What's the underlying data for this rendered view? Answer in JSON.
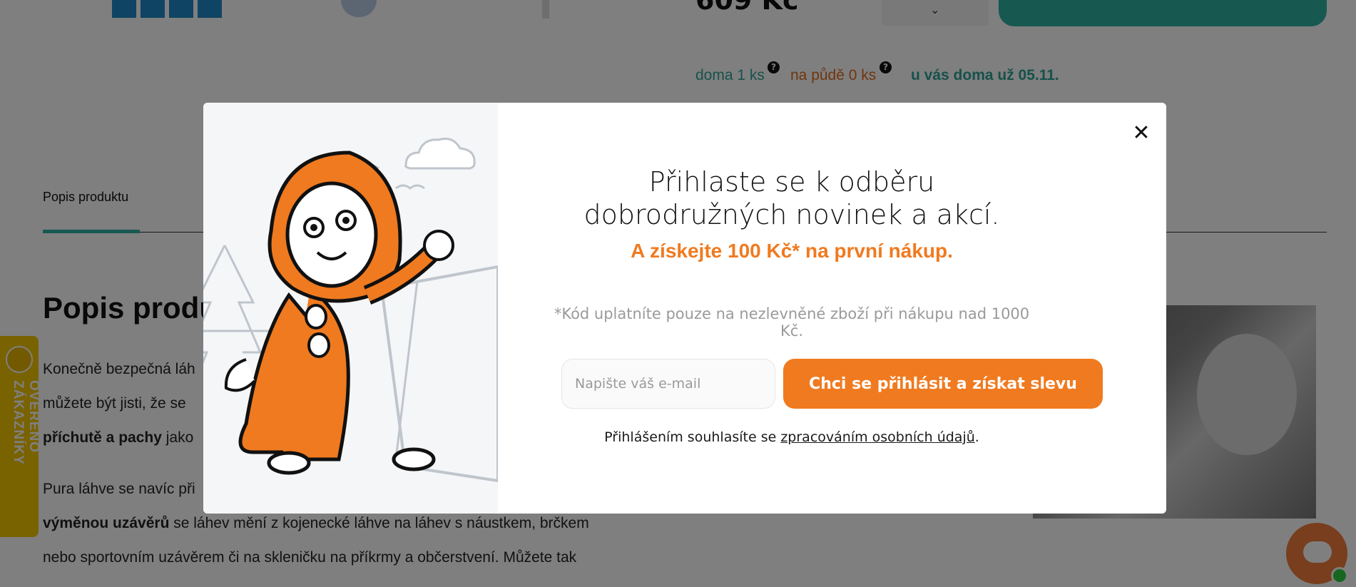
{
  "product": {
    "price": "609 Kč"
  },
  "stock": {
    "home": "doma 1 ks",
    "attic": "na půdě 0 ks",
    "delivery": "u vás doma už 05.11.",
    "help_glyph": "?"
  },
  "tabs": {
    "description": "Popis produktu"
  },
  "section": {
    "title": "Popis produ",
    "lines": [
      {
        "pre": "Konečně bezpečná láh",
        "bold": "",
        "post": ""
      },
      {
        "pre": "můžete být jisti, že se",
        "bold": "",
        "post": ""
      },
      {
        "pre": "",
        "bold": "příchutě a pachy",
        "post": " jako"
      },
      {
        "pre": "Pura láhve se navíc při",
        "bold": "",
        "post": ""
      },
      {
        "pre": "",
        "bold": "výměnou uzávěrů",
        "post": " se láhev mění z kojenecké láhve na láhev s náustkem, brčkem"
      },
      {
        "pre": "nebo sportovním uzávěrem či na skleničku na příkrmy a občerstvení. Můžete tak",
        "bold": "",
        "post": ""
      }
    ]
  },
  "badge": {
    "label": "OVĚŘENO ZÁKAZNÍKY"
  },
  "modal": {
    "close_glyph": "✕",
    "title": "Přihlaste se k odběru dobrodružných novinek a akcí.",
    "subtitle": "A získejte 100 Kč* na první nákup.",
    "note": "*Kód uplatníte pouze na nezlevněné zboží při nákupu nad 1000 Kč.",
    "email_placeholder": "Napište váš e-mail",
    "submit_label": "Chci se přihlásit a získat slevu",
    "consent_prefix": "Přihlášením souhlasíte se ",
    "consent_link": "zpracováním osobních údajů",
    "consent_suffix": "."
  },
  "colors": {
    "accent_orange": "#f07a1f",
    "accent_teal": "#2fb3a2",
    "badge_yellow": "#f2c400"
  },
  "icons": {
    "close": "close-icon",
    "help": "question-mark-icon",
    "chevron": "chevron-down-icon",
    "chat": "chat-bubble-icon"
  }
}
